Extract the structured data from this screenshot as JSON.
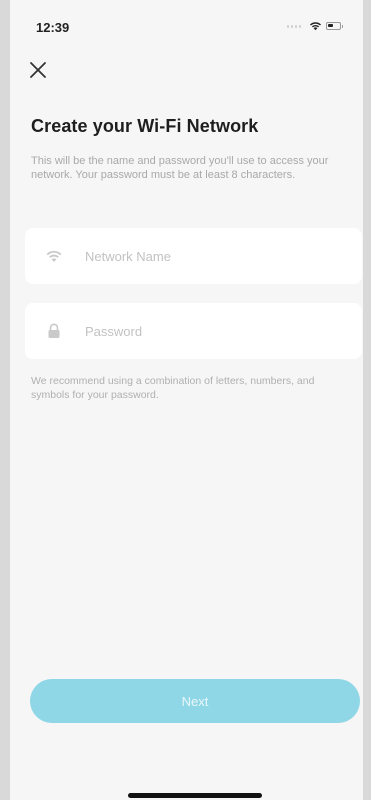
{
  "status_bar": {
    "time": "12:39"
  },
  "header": {
    "close_icon": "close-icon"
  },
  "main": {
    "title": "Create your Wi-Fi Network",
    "description": "This will be the name and password you'll use to access your network. Your password must be at least 8 characters.",
    "network_name": {
      "icon": "wifi-icon",
      "value": "",
      "placeholder": "Network Name"
    },
    "password": {
      "icon": "lock-icon",
      "value": "",
      "placeholder": "Password"
    },
    "hint": "We recommend using a combination of letters, numbers, and symbols for your password."
  },
  "footer": {
    "next_label": "Next"
  },
  "colors": {
    "accent": "#8fd7e6",
    "background": "#f6f6f6",
    "field_background": "#ffffff"
  }
}
